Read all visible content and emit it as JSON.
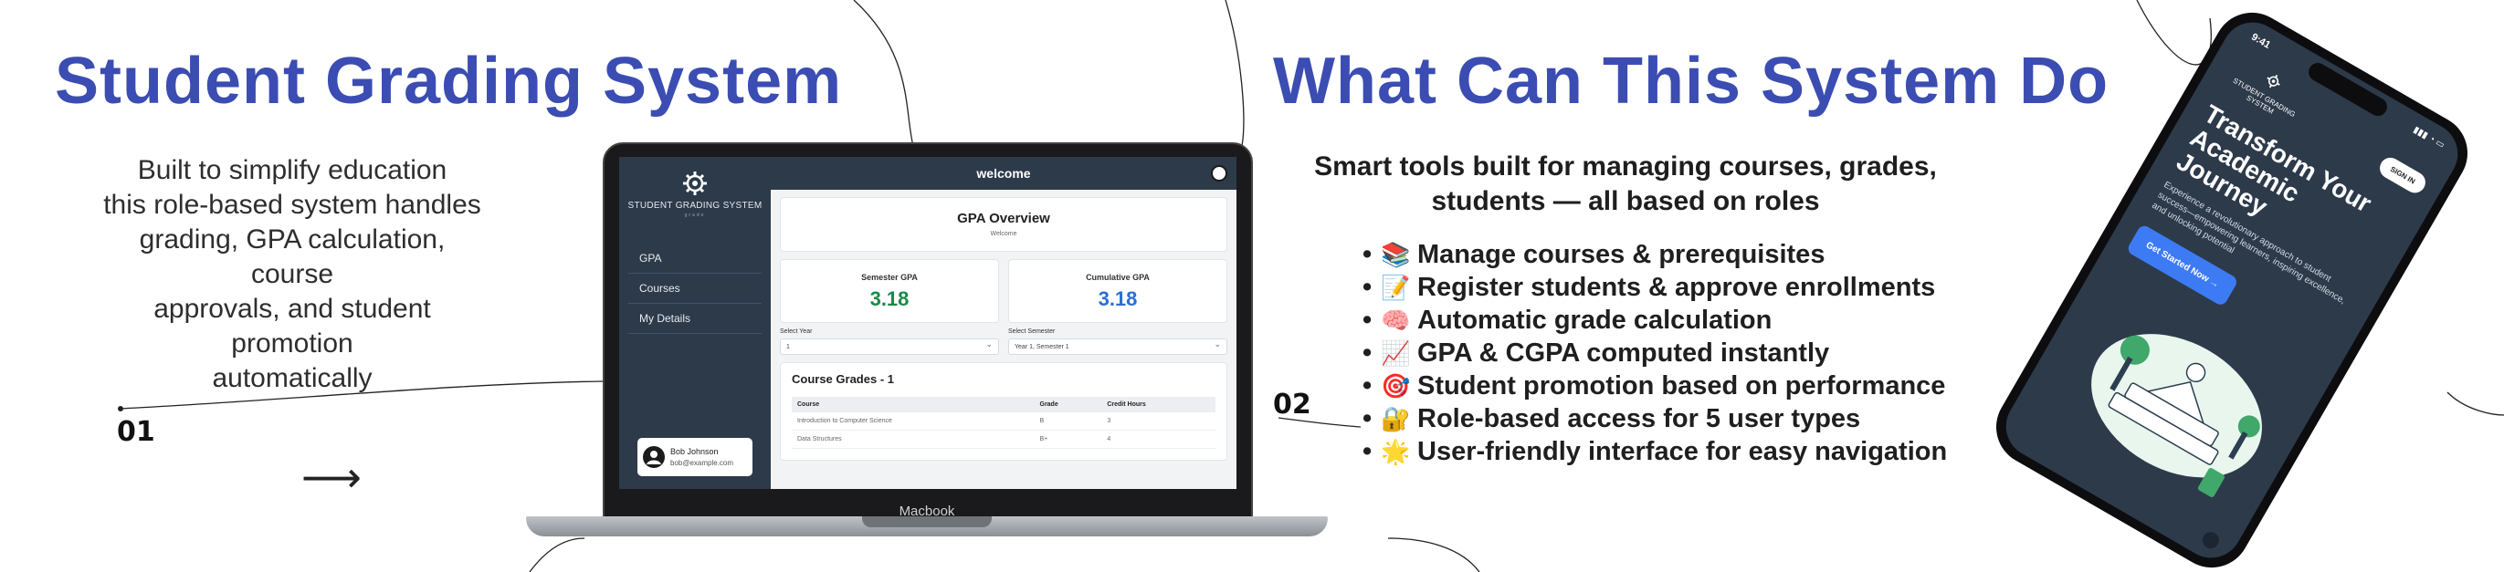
{
  "left": {
    "title": "Student Grading System",
    "intro": [
      "Built to simplify education",
      "this role-based system handles",
      "grading, GPA calculation, course",
      "approvals, and student promotion",
      "automatically"
    ],
    "step": "01"
  },
  "laptop": {
    "brand": "Macbook",
    "app": {
      "sidebar": {
        "logo_text": "STUDENT GRADING SYSTEM",
        "logo_sub": "grade",
        "nav": [
          "GPA",
          "Courses",
          "My Details"
        ],
        "user": {
          "name": "Bob Johnson",
          "email": "bob@example.com"
        }
      },
      "header_title": "welcome",
      "overview": {
        "title": "GPA Overview",
        "subtitle": "Welcome"
      },
      "gpa": {
        "semester_label": "Semester GPA",
        "semester_value": "3.18",
        "semester_color": "#1a8a4a",
        "cumulative_label": "Cumulative GPA",
        "cumulative_value": "3.18",
        "cumulative_color": "#2b6fd6"
      },
      "selects": {
        "year_label": "Select Year",
        "year_value": "1",
        "semester_label": "Select Semester",
        "semester_value": "Year 1, Semester 1"
      },
      "grades": {
        "title": "Course Grades - 1",
        "columns": [
          "Course",
          "Grade",
          "Credit Hours"
        ],
        "rows": [
          [
            "Introduction to Computer Science",
            "B",
            "3"
          ],
          [
            "Data Structures",
            "B+",
            "4"
          ]
        ]
      }
    }
  },
  "right": {
    "title": "What Can This System Do",
    "subtitle": [
      "Smart tools built for managing courses, grades,",
      "students — all based on roles"
    ],
    "step": "02",
    "features": [
      {
        "icon": "books-icon",
        "emoji": "📚",
        "text": "Manage courses & prerequisites"
      },
      {
        "icon": "memo-icon",
        "emoji": "📝",
        "text": "Register students & approve enrollments"
      },
      {
        "icon": "brain-icon",
        "emoji": "🧠",
        "text": "Automatic grade calculation"
      },
      {
        "icon": "chart-icon",
        "emoji": "📈",
        "text": "GPA & CGPA computed instantly"
      },
      {
        "icon": "target-icon",
        "emoji": "🎯",
        "text": "Student promotion based on performance"
      },
      {
        "icon": "lock-icon",
        "emoji": "🔐",
        "text": "Role-based access for 5 user types"
      },
      {
        "icon": "star-icon",
        "emoji": "🌟",
        "text": "User-friendly interface for easy navigation"
      }
    ]
  },
  "phone": {
    "time": "9:41",
    "logo_text": "STUDENT GRADING SYSTEM",
    "signin": "SIGN IN",
    "hero": "Transform Your Academic Journey",
    "desc": "Experience a revolutionary approach to student success—empowering learners, inspiring excellence, and unlocking potential",
    "cta": "Get Started Now →"
  },
  "colors": {
    "accent": "#3b4db2",
    "app_dark": "#2d3a4a",
    "cta_blue": "#3d7bf4"
  }
}
